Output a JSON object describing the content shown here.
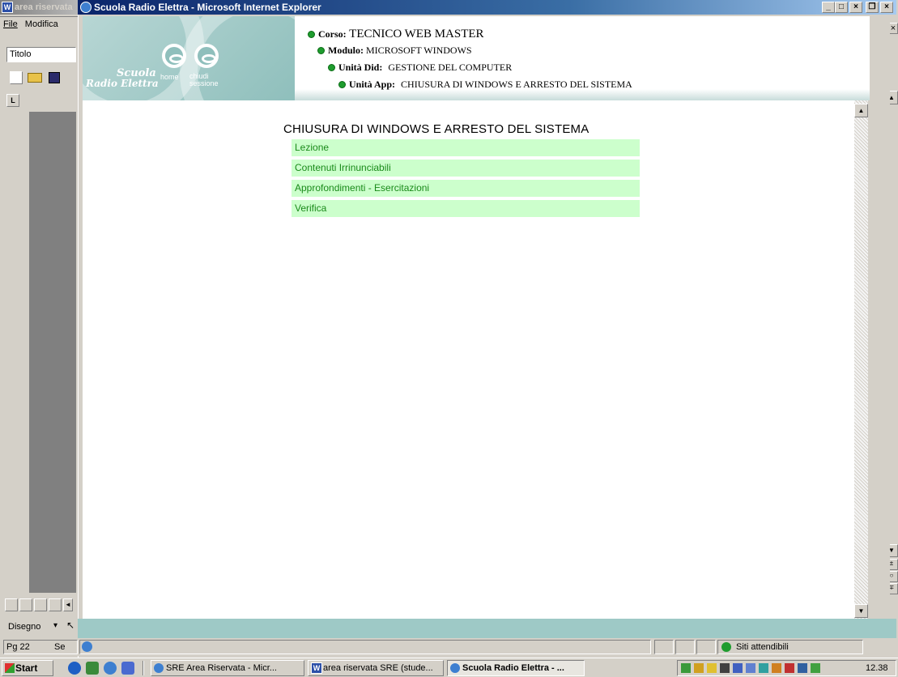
{
  "word": {
    "title": "area riservata",
    "menu": {
      "file": "File",
      "edit": "Modifica"
    },
    "style_box": "Titolo",
    "draw_label": "Disegno",
    "status_page": "Pg 22",
    "status_sec": "Se"
  },
  "ie": {
    "title": "Scuola Radio Elettra - Microsoft Internet Explorer",
    "status_zone": "Siti attendibili"
  },
  "banner": {
    "logo_line1": "Scuola",
    "logo_line2": "Radio Elettra",
    "home_label": "home",
    "logout_label": "chiudi sessione",
    "breadcrumbs": [
      {
        "label": "Corso:",
        "value": "TECNICO WEB MASTER"
      },
      {
        "label": "Modulo:",
        "value": "MICROSOFT WINDOWS"
      },
      {
        "label": "Unità Did:",
        "value": "GESTIONE DEL COMPUTER"
      },
      {
        "label": "Unità App:",
        "value": "CHIUSURA DI WINDOWS E ARRESTO DEL SISTEMA"
      }
    ]
  },
  "page": {
    "heading": "CHIUSURA DI WINDOWS E ARRESTO DEL SISTEMA",
    "menu": [
      "Lezione",
      "Contenuti Irrinunciabili",
      "Approfondimenti - Esercitazioni",
      "Verifica"
    ]
  },
  "taskbar": {
    "start": "Start",
    "tasks": [
      "SRE Area Riservata - Micr...",
      "area riservata SRE (stude...",
      "Scuola Radio Elettra - ..."
    ],
    "clock": "12.38"
  },
  "colors": {
    "menu_bg": "#ccffcc",
    "menu_text": "#1a8a1a",
    "title_active": "#0a246a",
    "teal": "#9ec9c6"
  }
}
